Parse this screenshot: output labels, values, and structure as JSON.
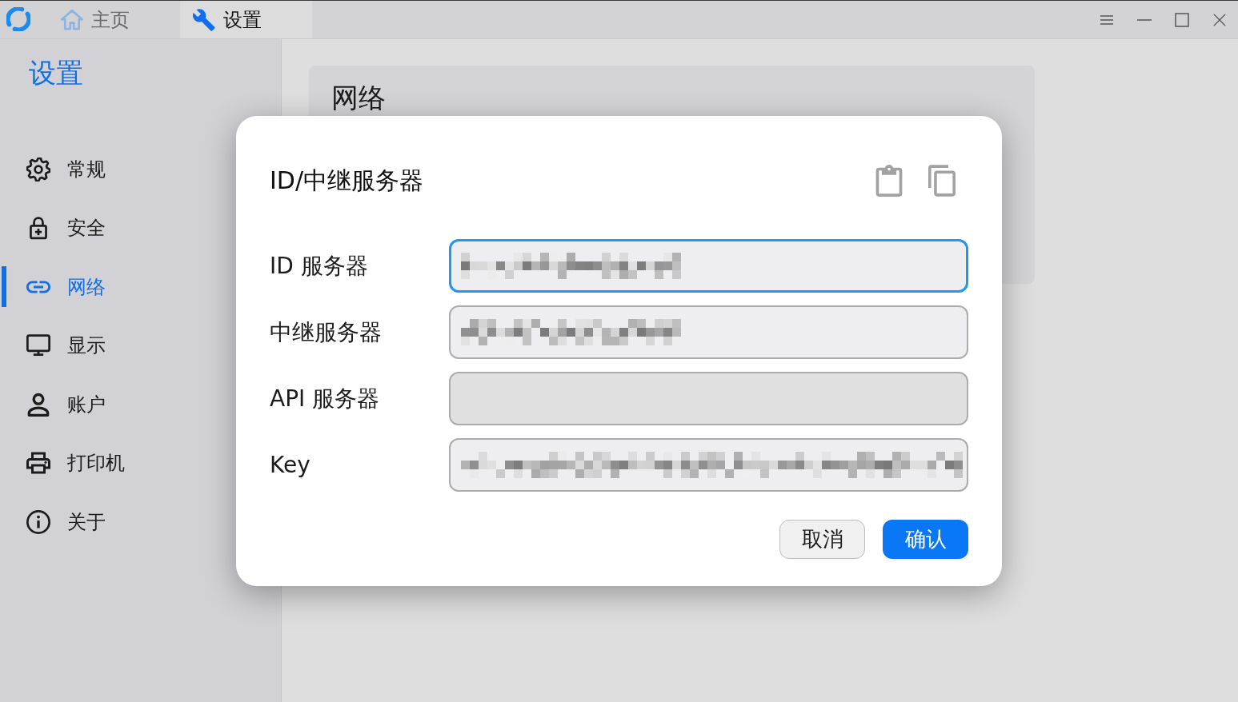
{
  "title_bar": {
    "tabs": [
      {
        "label": "主页",
        "selected": false
      },
      {
        "label": "设置",
        "selected": true
      }
    ]
  },
  "sidebar": {
    "title": "设置",
    "items": [
      {
        "label": "常规",
        "selected": false
      },
      {
        "label": "安全",
        "selected": false
      },
      {
        "label": "网络",
        "selected": true
      },
      {
        "label": "显示",
        "selected": false
      },
      {
        "label": "账户",
        "selected": false
      },
      {
        "label": "打印机",
        "selected": false
      },
      {
        "label": "关于",
        "selected": false
      }
    ]
  },
  "content": {
    "section_title": "网络"
  },
  "dialog": {
    "title": "ID/中继服务器",
    "fields": [
      {
        "label": "ID 服务器",
        "kind": "text",
        "focused": true,
        "disabled": false,
        "redacted": true
      },
      {
        "label": "中继服务器",
        "kind": "text",
        "focused": false,
        "disabled": false,
        "redacted": true
      },
      {
        "label": "API 服务器",
        "kind": "text",
        "focused": false,
        "disabled": true,
        "redacted": false
      },
      {
        "label": "Key",
        "kind": "key",
        "focused": false,
        "disabled": false,
        "redacted": true
      }
    ],
    "buttons": [
      {
        "label": "取消",
        "kind": "secondary"
      },
      {
        "label": "确认",
        "kind": "primary"
      }
    ]
  }
}
